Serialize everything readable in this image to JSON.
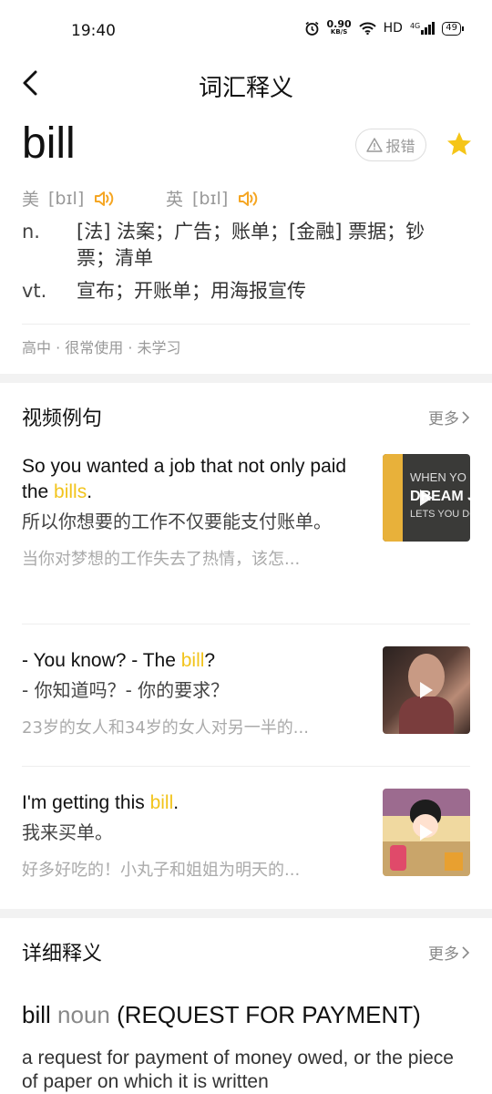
{
  "status": {
    "time": "19:40",
    "speed_value": "0.90",
    "speed_unit": "KB/S",
    "hd": "HD",
    "signal": "4G",
    "battery": "49"
  },
  "nav": {
    "title": "词汇释义",
    "back_icon": "chevron-left-icon"
  },
  "word": {
    "text": "bill",
    "report_label": "报错",
    "favorited": true,
    "star_color": "#f5c518",
    "us": {
      "label": "美",
      "ipa": "[bɪl]"
    },
    "uk": {
      "label": "英",
      "ipa": "[bɪl]"
    },
    "definitions": [
      {
        "pos": "n.",
        "text": "[法] 法案；广告；账单；[金融] 票据；钞票；清单"
      },
      {
        "pos": "vt.",
        "text": "宣布；开账单；用海报宣传"
      }
    ],
    "tags": "高中 · 很常使用 · 未学习"
  },
  "video_examples": {
    "title": "视频例句",
    "more_label": "更多",
    "items": [
      {
        "en_pre": "So you wanted a job that not only paid the ",
        "en_hl": "bills",
        "en_post": ".",
        "zh": "所以你想要的工作不仅要能支付账单。",
        "source": "当你对梦想的工作失去了热情，该怎...",
        "thumb_text_1": "WHEN YO",
        "thumb_text_2": "DREAM J",
        "thumb_text_3": "LETS YOU DO"
      },
      {
        "en_pre": "- You know?  - The ",
        "en_hl": "bill",
        "en_post": "?",
        "zh": "- 你知道吗？- 你的要求？",
        "source": "23岁的女人和34岁的女人对另一半的..."
      },
      {
        "en_pre": "I'm getting this ",
        "en_hl": "bill",
        "en_post": ".",
        "zh": "我来买单。",
        "source": "好多好吃的！小丸子和姐姐为明天的..."
      }
    ]
  },
  "detail": {
    "title": "详细释义",
    "more_label": "更多",
    "word": "bill",
    "pos": "noun",
    "sense": "(REQUEST FOR PAYMENT)",
    "definition": "a request for payment of money owed, or the piece of paper on which it is written"
  },
  "colors": {
    "highlight": "#f2c41c",
    "speaker": "#f5a623"
  }
}
